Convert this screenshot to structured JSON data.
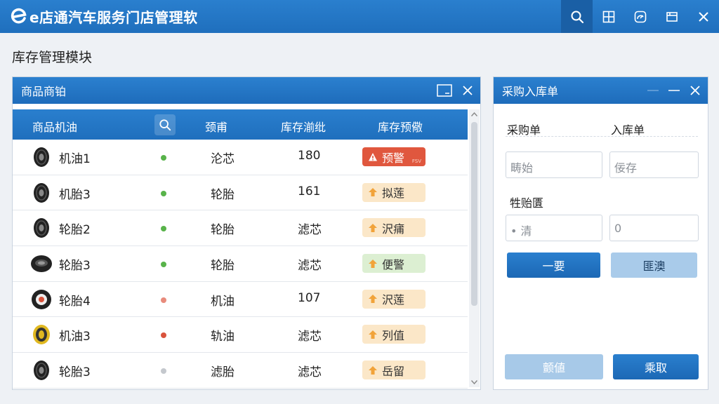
{
  "app": {
    "title": "e店通汽车服务门店管理软"
  },
  "page_title": "库存管理模块",
  "products_panel": {
    "title": "商品商铂",
    "columns": [
      "商品机油",
      "颈甫",
      "库存湔纰",
      "库存预儆"
    ],
    "rows": [
      {
        "name": "机油1",
        "status": "green",
        "category": "沦芯",
        "qty": "180",
        "badge": "预警",
        "badge_type": "red",
        "badge_sub": "FSV",
        "tire": "black"
      },
      {
        "name": "机胎3",
        "status": "green",
        "category": "轮胎",
        "qty": "161",
        "badge": "拟莲",
        "badge_type": "orange",
        "tire": "black"
      },
      {
        "name": "轮胎2",
        "status": "green",
        "category": "轮胎",
        "qty": "滤芯",
        "badge": "沢痡",
        "badge_type": "orange",
        "tire": "black"
      },
      {
        "name": "轮胎3",
        "status": "green",
        "category": "轮胎",
        "qty": "滤芯",
        "badge": "便警",
        "badge_type": "green",
        "tire": "flat"
      },
      {
        "name": "轮胎4",
        "status": "pink",
        "category": "机油",
        "qty": "107",
        "badge": "沢莲",
        "badge_type": "orange",
        "tire": "red"
      },
      {
        "name": "机油3",
        "status": "red",
        "category": "轨油",
        "qty": "滤芯",
        "badge": "列值",
        "badge_type": "orange",
        "tire": "yellow"
      },
      {
        "name": "轮胎3",
        "status": "grey",
        "category": "滤胎",
        "qty": "滤芯",
        "badge": "岳留",
        "badge_type": "orange",
        "tire": "black"
      }
    ]
  },
  "order_panel": {
    "title": "采购入库单",
    "purchase_label": "采购单",
    "stockin_label": "入库单",
    "field1_placeholder": "畴始",
    "field2_placeholder": "佞存",
    "section_label": "牲贻匱",
    "field3_value": "• 清",
    "field4_value": "0",
    "button1": "一要",
    "button2": "匪澳",
    "button3": "颤値",
    "button4": "乘取"
  },
  "colors": {
    "accent": "#1f6fbd",
    "warn_red": "#e0573e",
    "warn_orange": "#fbe7c8",
    "ok_green": "#dcefd2"
  }
}
